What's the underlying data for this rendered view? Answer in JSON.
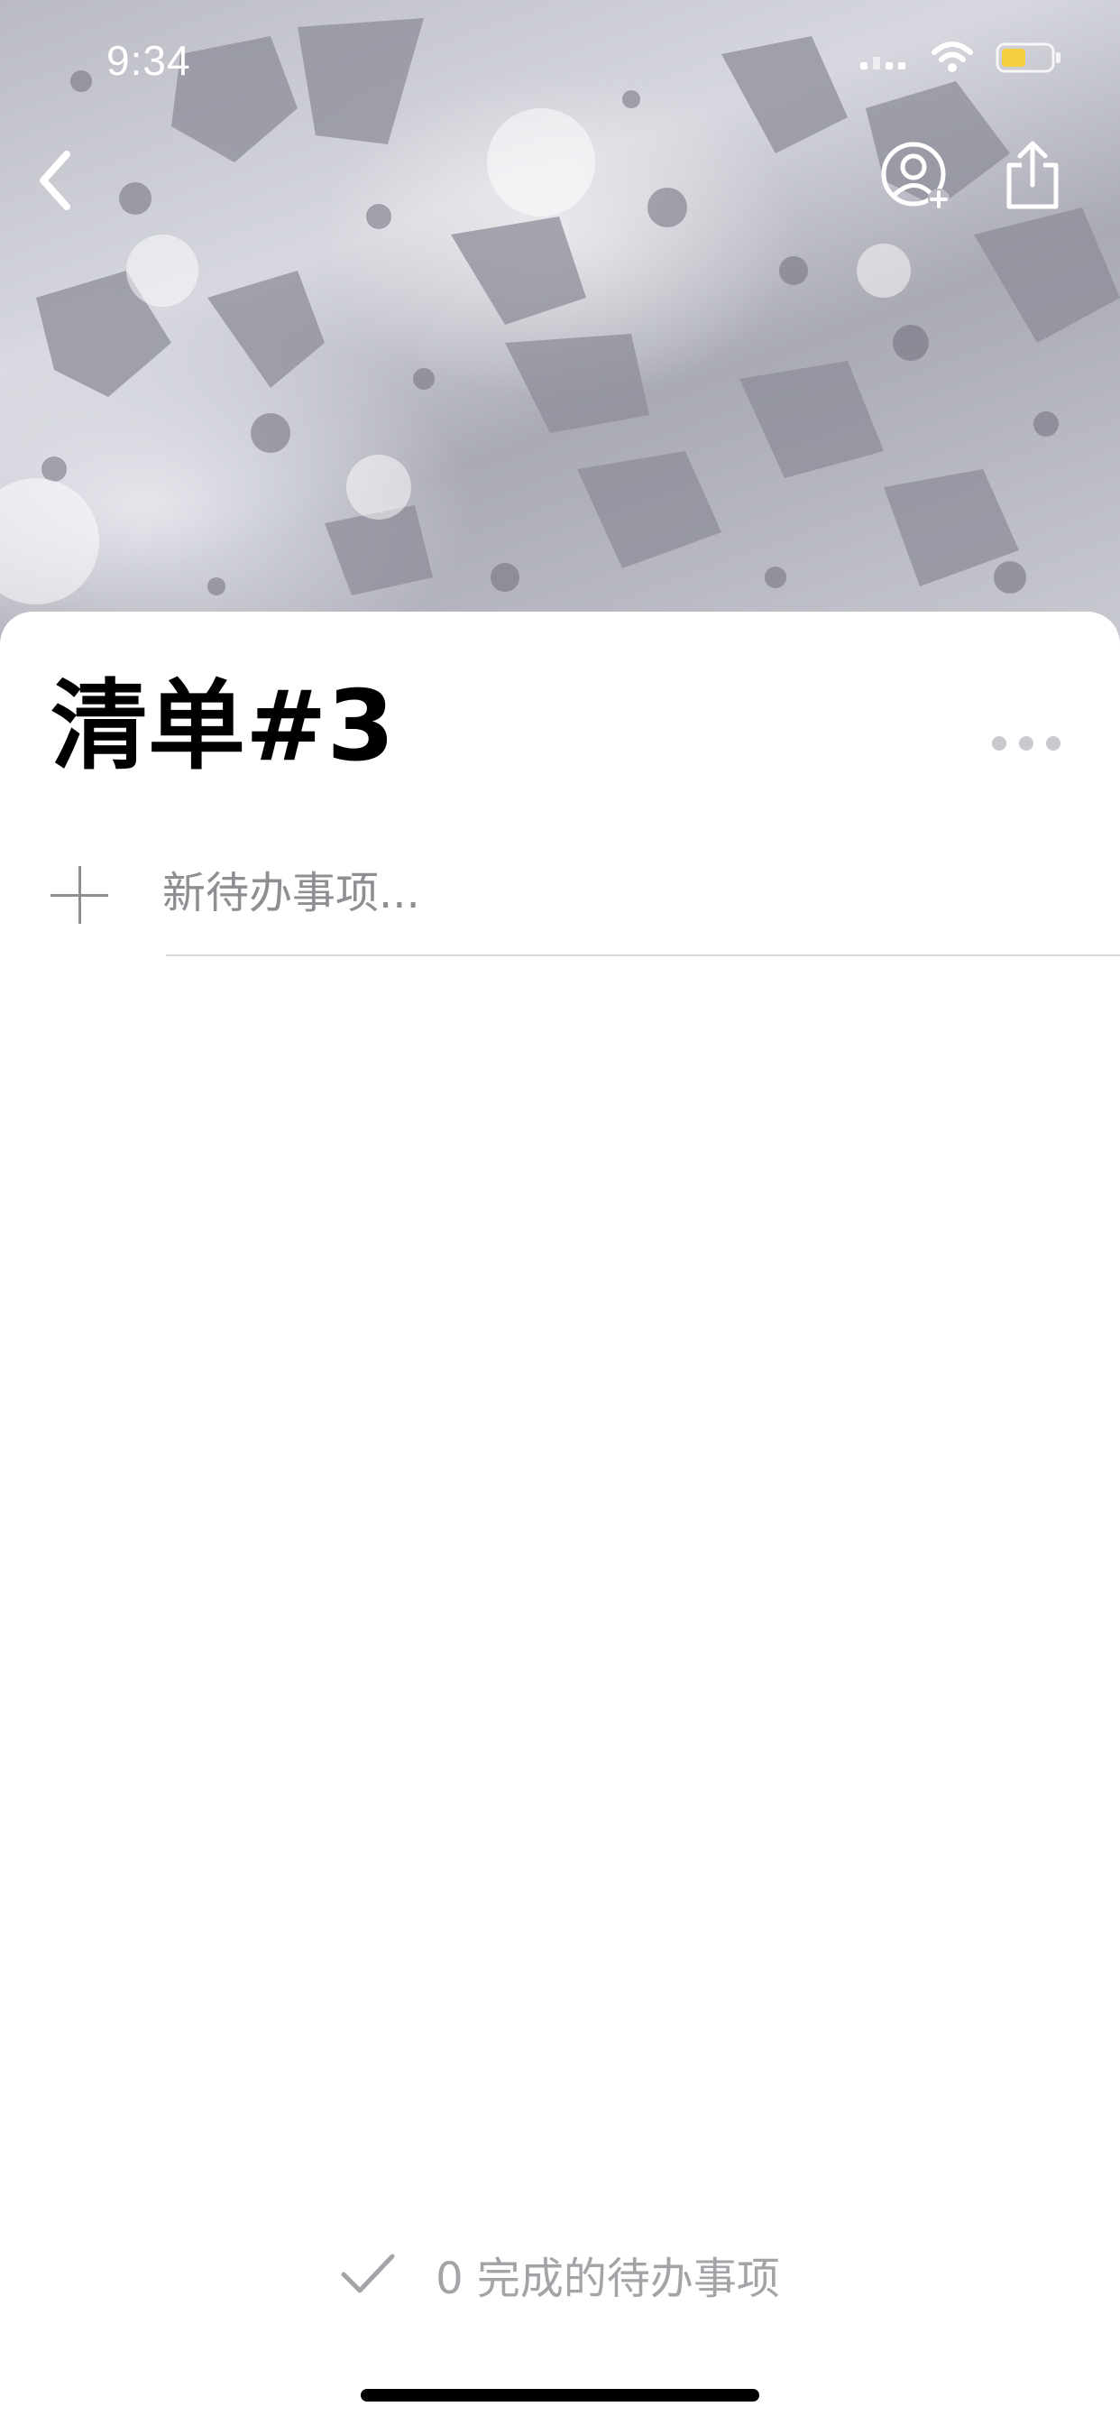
{
  "status_bar": {
    "time": "9:34",
    "icons": [
      "signal-icon",
      "wifi-icon",
      "battery-icon"
    ],
    "battery_color": "#f4d03f"
  },
  "header": {
    "back_icon": "chevron-left-icon",
    "add_member_icon": "person-add-icon",
    "share_icon": "share-icon"
  },
  "list": {
    "title": "清单#3",
    "more_icon": "ellipsis-icon",
    "new_item_placeholder": "新待办事项..."
  },
  "footer": {
    "completed_text": "0 完成的待办事项",
    "check_icon": "checkmark-icon"
  },
  "colors": {
    "accent_gray": "#8e8e93",
    "background": "#ffffff"
  }
}
